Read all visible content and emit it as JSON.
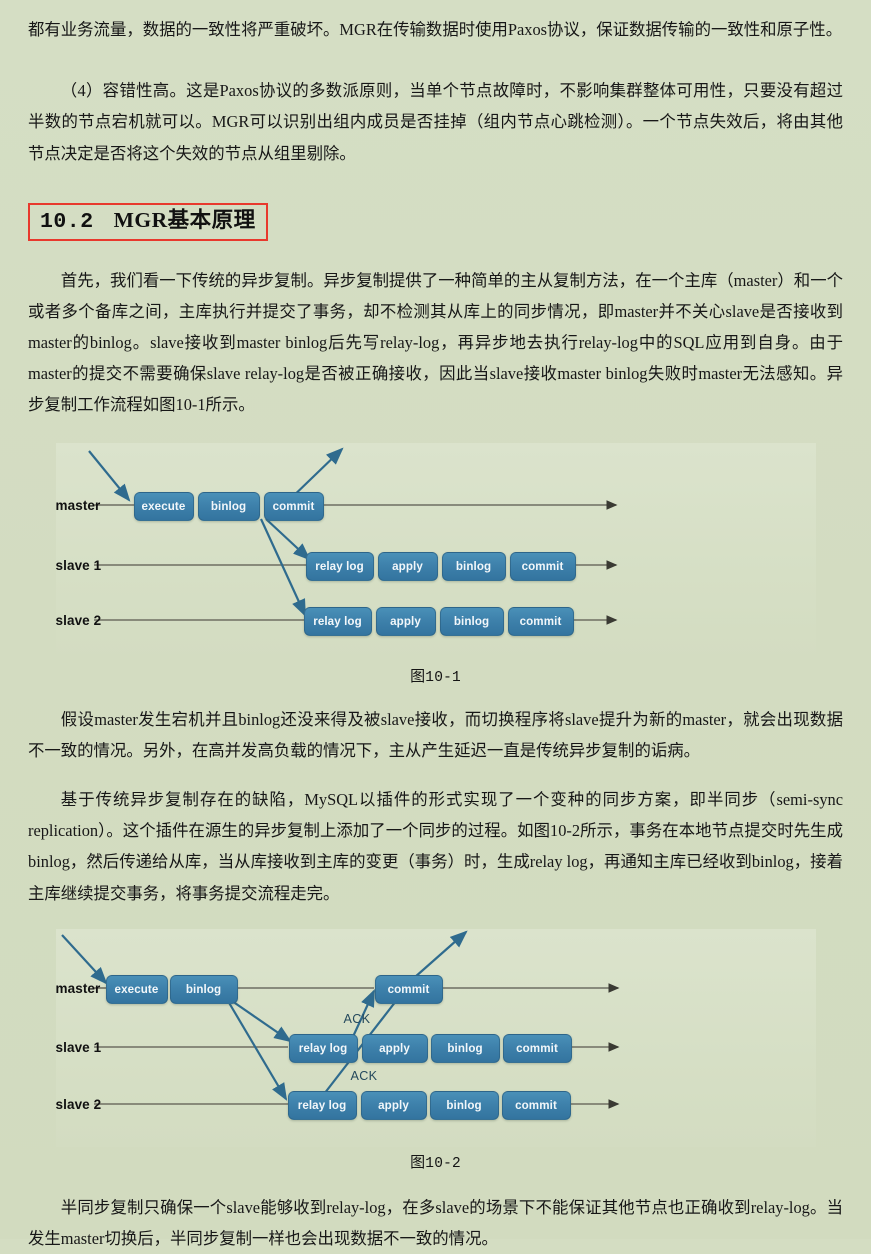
{
  "page": {
    "background_color": "#d4ddc2",
    "text_color": "#171717"
  },
  "paragraphs": {
    "p1": "都有业务流量，数据的一致性将严重破坏。MGR在传输数据时使用Paxos协议，保证数据传输的一致性和原子性。",
    "p2": "（4）容错性高。这是Paxos协议的多数派原则，当单个节点故障时，不影响集群整体可用性，只要没有超过半数的节点宕机就可以。MGR可以识别出组内成员是否挂掉（组内节点心跳检测）。一个节点失效后，将由其他节点决定是否将这个失效的节点从组里剔除。",
    "p3": "首先，我们看一下传统的异步复制。异步复制提供了一种简单的主从复制方法，在一个主库（master）和一个或者多个备库之间，主库执行并提交了事务，却不检测其从库上的同步情况，即master并不关心slave是否接收到master的binlog。slave接收到master binlog后先写relay-log，再异步地去执行relay-log中的SQL应用到自身。由于master的提交不需要确保slave relay-log是否被正确接收，因此当slave接收master binlog失败时master无法感知。异步复制工作流程如图10-1所示。",
    "p4": "假设master发生宕机并且binlog还没来得及被slave接收，而切换程序将slave提升为新的master，就会出现数据不一致的情况。另外，在高并发高负载的情况下，主从产生延迟一直是传统异步复制的诟病。",
    "p5": "基于传统异步复制存在的缺陷，MySQL以插件的形式实现了一个变种的同步方案，即半同步（semi-sync replication）。这个插件在源生的异步复制上添加了一个同步的过程。如图10-2所示，事务在本地节点提交时先生成binlog，然后传递给从库，当从库接收到主库的变更（事务）时，生成relay log，再通知主库已经收到binlog，接着主库继续提交事务，将事务提交流程走完。",
    "p6": "半同步复制只确保一个slave能够收到relay-log，在多slave的场景下不能保证其他节点也正确收到relay-log。当发生master切换后，半同步复制一样也会出现数据不一致的情况。"
  },
  "heading": {
    "number": "10.2",
    "title": "MGR基本原理",
    "border_color": "#e8392d"
  },
  "figure1": {
    "caption_prefix": "图",
    "caption_number": "10-1",
    "node_color": "#3e81ab",
    "rows": [
      {
        "label": "master",
        "nodes": [
          "execute",
          "binlog",
          "commit"
        ]
      },
      {
        "label": "slave 1",
        "nodes": [
          "relay log",
          "apply",
          "binlog",
          "commit"
        ]
      },
      {
        "label": "slave 2",
        "nodes": [
          "relay log",
          "apply",
          "binlog",
          "commit"
        ]
      }
    ]
  },
  "figure2": {
    "caption_prefix": "图",
    "caption_number": "10-2",
    "node_color": "#3e81ab",
    "ack_labels": [
      "ACK",
      "ACK"
    ],
    "rows": [
      {
        "label": "master",
        "nodes": [
          "execute",
          "binlog",
          "commit"
        ]
      },
      {
        "label": "slave 1",
        "nodes": [
          "relay log",
          "apply",
          "binlog",
          "commit"
        ]
      },
      {
        "label": "slave 2",
        "nodes": [
          "relay log",
          "apply",
          "binlog",
          "commit"
        ]
      }
    ]
  }
}
